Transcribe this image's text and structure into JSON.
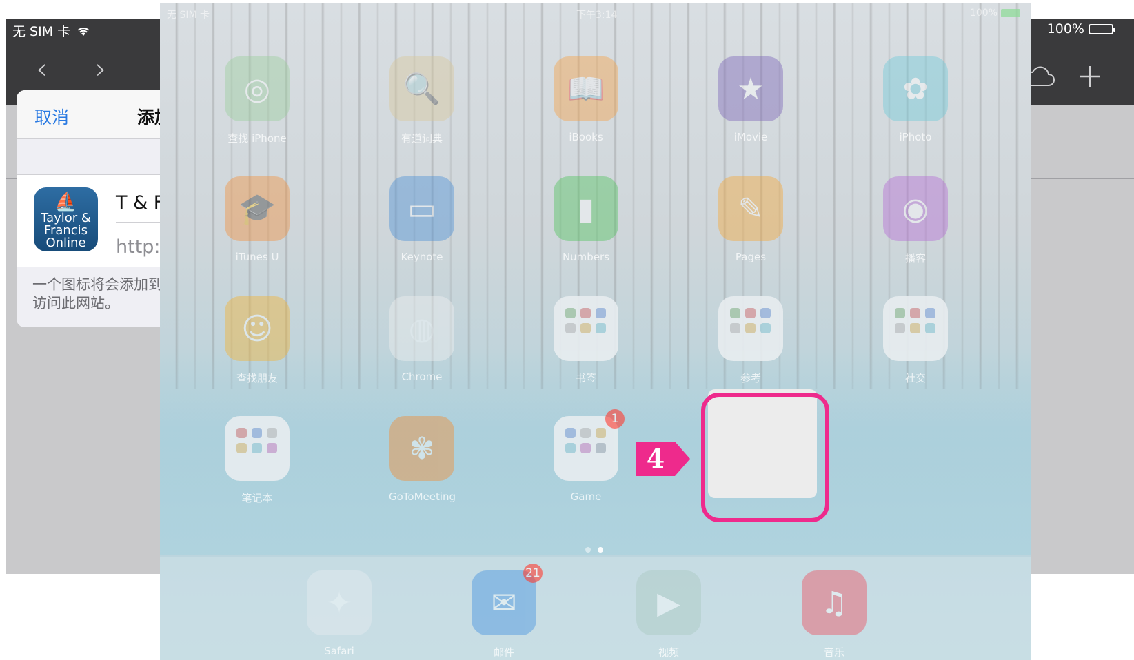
{
  "background": {
    "status_bar": {
      "carrier": "无 SIM 卡",
      "battery": "100%"
    },
    "toolbar_icons": {
      "back": "chevron-left",
      "forward": "chevron-right",
      "cloud": "cloud",
      "add": "plus"
    },
    "dialog": {
      "cancel": "取消",
      "title_visible": "添加",
      "app_icon_text": "Taylor & Francis Online",
      "name": "T & F",
      "url": "http://",
      "note_line1": "一个图标将会添加到",
      "note_line2": "访问此网站。"
    }
  },
  "overlay": {
    "status_bar": {
      "carrier": "无 SIM 卡",
      "time": "下午3:14",
      "battery": "100%"
    },
    "apps": [
      {
        "label": "查找 iPhone",
        "icon": "find-iphone-icon",
        "color": "#9bcf9d"
      },
      {
        "label": "有道词典",
        "icon": "dictionary-icon",
        "color": "#d9c89a"
      },
      {
        "label": "iBooks",
        "icon": "ibooks-icon",
        "color": "#f7a144"
      },
      {
        "label": "iMovie",
        "icon": "imovie-icon",
        "color": "#7a63b8"
      },
      {
        "label": "iPhoto",
        "icon": "iphoto-icon",
        "color": "#6ecad9"
      },
      {
        "label": "iTunes U",
        "icon": "itunes-u-icon",
        "color": "#f4913c"
      },
      {
        "label": "Keynote",
        "icon": "keynote-icon",
        "color": "#4a8fd6"
      },
      {
        "label": "Numbers",
        "icon": "numbers-icon",
        "color": "#4fc45c"
      },
      {
        "label": "Pages",
        "icon": "pages-icon",
        "color": "#f7a836"
      },
      {
        "label": "播客",
        "icon": "podcasts-icon",
        "color": "#b56ad6"
      },
      {
        "label": "查找朋友",
        "icon": "find-friends-icon",
        "color": "#f5b330"
      },
      {
        "label": "Chrome",
        "icon": "chrome-icon",
        "color": "#f0f0f0"
      },
      {
        "label": "书签",
        "icon": "folder-icon",
        "color": "#e8edf0"
      },
      {
        "label": "参考",
        "icon": "folder-icon",
        "color": "#e8edf0"
      },
      {
        "label": "社交",
        "icon": "folder-icon",
        "color": "#e8edf0"
      },
      {
        "label": "笔记本",
        "icon": "folder-icon",
        "color": "#e8edf0"
      },
      {
        "label": "GoToMeeting",
        "icon": "gotomeeting-icon",
        "color": "#f58b2e"
      },
      {
        "label": "Game",
        "icon": "folder-icon",
        "color": "#e8edf0",
        "badge": "1"
      }
    ],
    "dock": [
      {
        "label": "Safari",
        "icon": "safari-icon",
        "color": "#e8edf2"
      },
      {
        "label": "邮件",
        "icon": "mail-icon",
        "color": "#3d8ee0",
        "badge": "21"
      },
      {
        "label": "视频",
        "icon": "videos-icon",
        "color": "#a9c9c0"
      },
      {
        "label": "音乐",
        "icon": "music-icon",
        "color": "#f04a5a"
      }
    ],
    "step_number": "4",
    "highlight_color": "#ee2a8c"
  }
}
